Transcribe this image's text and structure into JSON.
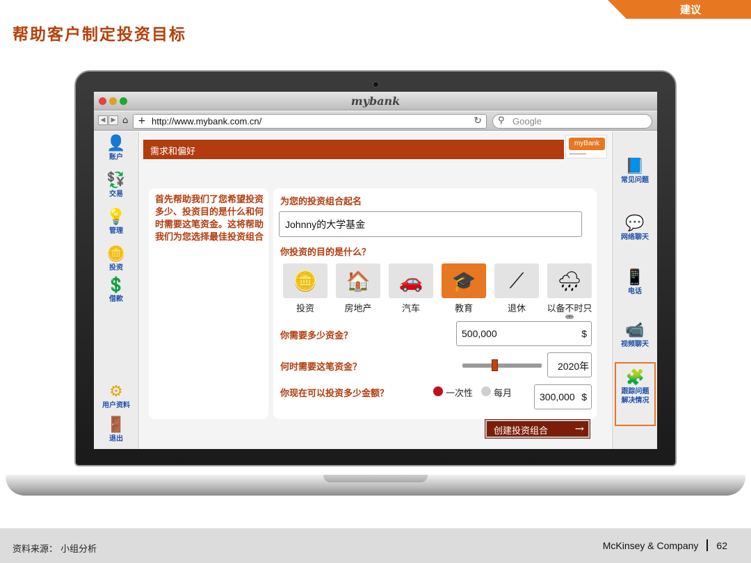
{
  "slide": {
    "tag": "建议",
    "title": "帮助客户制定投资目标",
    "source": "资料来源： 小组分析",
    "company": "McKinsey & Company",
    "page_number": "62"
  },
  "browser": {
    "window_title": "mybank",
    "url": "http://www.mybank.com.cn/",
    "search_placeholder": "Google"
  },
  "left_nav": {
    "items": [
      {
        "label": "账户",
        "icon": "user-icon"
      },
      {
        "label": "交易",
        "icon": "money-icon"
      },
      {
        "label": "管理",
        "icon": "lightbulb-icon"
      },
      {
        "label": "投资",
        "icon": "coins-icon"
      },
      {
        "label": "借款",
        "icon": "loan-icon"
      }
    ],
    "bottom_items": [
      {
        "label": "用户资料",
        "icon": "gear-icon"
      },
      {
        "label": "退出",
        "icon": "exit-door-icon"
      }
    ]
  },
  "right_nav": {
    "items": [
      {
        "label": "常见问题",
        "icon": "faq-book-icon"
      },
      {
        "label": "网络聊天",
        "icon": "chat-person-icon"
      },
      {
        "label": "电话",
        "icon": "phone-icon"
      },
      {
        "label": "视频聊天",
        "icon": "video-icon"
      },
      {
        "label": "跟踪问题\n解决情况",
        "icon": "puzzle-icon",
        "highlighted": true
      }
    ]
  },
  "main": {
    "section_title": "需求和偏好",
    "brand_badge": "myBank",
    "intro": "首先帮助我们了您希望投资多少、投资目的是什么和何时需要这笔资金。这将帮助我们为您选择最佳投资组合",
    "portfolio_name_label": "为您的投资组合起名",
    "portfolio_name_value": "Johnny的大学基金",
    "goal_question": "你投资的目的是什么？",
    "goals": [
      {
        "label": "投资",
        "icon": "coins-stack-icon",
        "selected": false
      },
      {
        "label": "房地产",
        "icon": "house-icon",
        "selected": false
      },
      {
        "label": "汽车",
        "icon": "car-icon",
        "selected": false
      },
      {
        "label": "教育",
        "icon": "graduation-cap-icon",
        "selected": true
      },
      {
        "label": "退休",
        "icon": "cane-icon",
        "selected": false
      },
      {
        "label": "以备不时只需",
        "icon": "rain-cloud-icon",
        "selected": false
      }
    ],
    "amount_question": "你需要多少资金？",
    "amount_value": "500,000",
    "amount_currency": "$",
    "when_question": "何时需要这笔资金？",
    "year_value": "2020年",
    "year_slider_position": 0.42,
    "invest_question": "你现在可以投资多少金额？",
    "frequency_options": [
      {
        "label": "一次性",
        "selected": true
      },
      {
        "label": "每月",
        "selected": false
      }
    ],
    "invest_value": "300,000",
    "invest_currency": "$",
    "create_button": "创建投资组合",
    "create_arrow": "→"
  },
  "colors": {
    "accent": "#b23c0e",
    "orange": "#e87722",
    "button_dark": "#7a1e0a",
    "nav_blue": "#1f4ea8"
  }
}
